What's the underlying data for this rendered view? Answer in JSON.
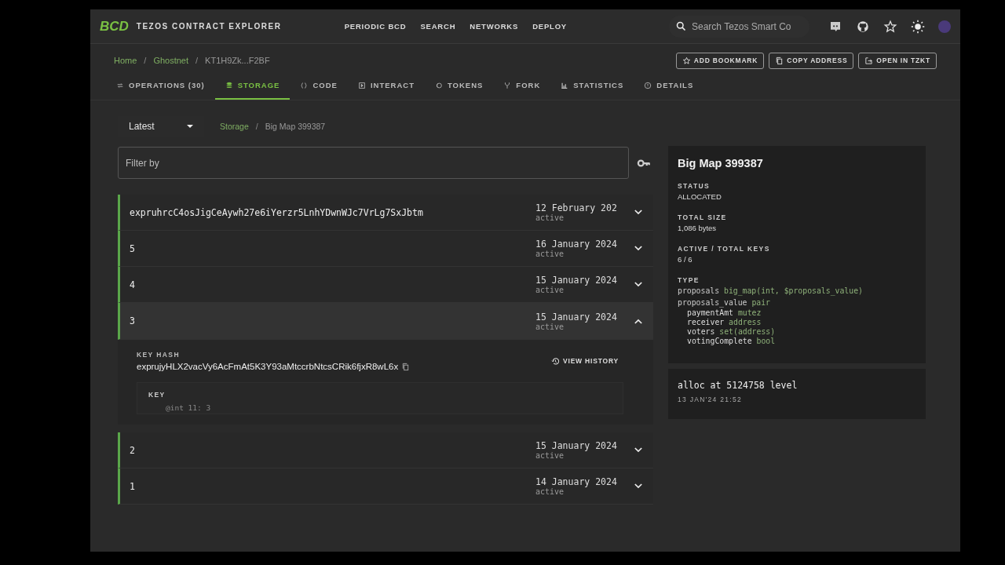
{
  "header": {
    "logo": "BCD",
    "title": "TEZOS CONTRACT EXPLORER",
    "nav": [
      "PERIODIC BCD",
      "SEARCH",
      "NETWORKS",
      "DEPLOY"
    ],
    "search": {
      "placeholder": "Search Tezos Smart Co"
    }
  },
  "breadcrumb": [
    {
      "label": "Home",
      "link": true
    },
    {
      "separator": "/",
      "label": "Ghostnet",
      "link": true
    },
    {
      "separator": "/",
      "label": "KT1H9Zk...F2BF",
      "link": false
    }
  ],
  "actions": [
    "ADD BOOKMARK",
    "COPY ADDRESS",
    "OPEN IN TZKT"
  ],
  "tabs": [
    {
      "label": "OPERATIONS (30)",
      "selected": false
    },
    {
      "label": "STORAGE",
      "selected": true
    },
    {
      "label": "CODE",
      "selected": false
    },
    {
      "label": "INTERACT",
      "selected": false
    },
    {
      "label": "TOKENS",
      "selected": false
    },
    {
      "label": "FORK",
      "selected": false
    },
    {
      "label": "STATISTICS",
      "selected": false
    },
    {
      "label": "DETAILS",
      "selected": false
    }
  ],
  "version_select": {
    "value": "Latest"
  },
  "storage_path": [
    {
      "label": "Storage",
      "link": true
    },
    {
      "separator": "/",
      "label": "Big Map 399387",
      "link": false
    }
  ],
  "filter": {
    "placeholder": "Filter by"
  },
  "entries": [
    {
      "key": "expruhrcC4osJigCeAywh27e6iYerzr5LnhYDwnWJc7VrLg7SxJbtm",
      "date": "12 February 202",
      "status": "active",
      "expanded": false
    },
    {
      "key": "5",
      "date": "16 January 2024",
      "status": "active",
      "expanded": false
    },
    {
      "key": "4",
      "date": "15 January 2024",
      "status": "active",
      "expanded": false
    },
    {
      "key": "3",
      "date": "15 January 2024",
      "status": "active",
      "expanded": true
    },
    {
      "key": "2",
      "date": "15 January 2024",
      "status": "active",
      "expanded": false
    },
    {
      "key": "1",
      "date": "14 January 2024",
      "status": "active",
      "expanded": false
    }
  ],
  "expanded_detail": {
    "key_hash_label": "KEY HASH",
    "key_hash": "exprujyHLX2vacVy6AcFmAt5K3Y93aMtccrbNtcsCRik6fjxR8wL6x",
    "view_history": "VIEW HISTORY",
    "key_label": "KEY",
    "key_value": "@int 11: 3"
  },
  "info_panel": {
    "title": "Big Map 399387",
    "fields": [
      {
        "label": "STATUS",
        "value": "ALLOCATED"
      },
      {
        "label": "TOTAL SIZE",
        "value": "1,086 bytes"
      },
      {
        "label": "ACTIVE / TOTAL KEYS",
        "value": "6 / 6"
      }
    ],
    "type_label": "TYPE",
    "type_lines": [
      {
        "name": "proposals",
        "type": "big_map(int, $proposals_value)"
      },
      {
        "name": "proposals_value",
        "type": "pair",
        "children": [
          {
            "name": "paymentAmt",
            "type": "mutez"
          },
          {
            "name": "receiver",
            "type": "address"
          },
          {
            "name": "voters",
            "type": "set(address)"
          },
          {
            "name": "votingComplete",
            "type": "bool"
          }
        ]
      }
    ]
  },
  "alloc_panel": {
    "text": "alloc at 5124758 level",
    "time": "13 JAN'24 21:52"
  }
}
